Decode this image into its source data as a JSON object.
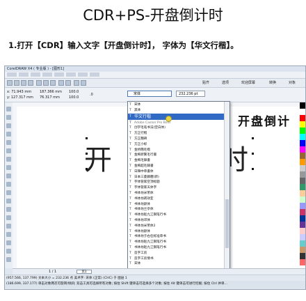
{
  "heading": "CDR+PS-开盘倒计时",
  "step1": "1.打开【CDR】输入文字【开盘倒计时】， 字体为【华文行楷】。",
  "app": {
    "window_title": "CorelDRAW X4 ( 专业版 ) - [图形1]",
    "toolbar_labels": [
      "贴齐",
      "选项",
      "欢迎屏幕",
      "转换",
      "对象"
    ],
    "coords": {
      "x": "x: 71.943 mm",
      "y": "y: 127.317 mm",
      "w": "187.366 mm",
      "h": "76.317 mm",
      "sx": "100.0",
      "sy": "100.0",
      "angle": ".0"
    },
    "font_value": "宋体",
    "size_value": "232.236 pt"
  },
  "dropdown": {
    "items": [
      {
        "label": "宋体",
        "state": "normal"
      },
      {
        "label": "黑体",
        "state": "normal"
      },
      {
        "label": "华文行楷",
        "state": "selected"
      },
      {
        "label": "Adobe Caslon Pro Bold",
        "state": "dim"
      },
      {
        "label": "创学毛笔书法(空白体)",
        "state": "normal"
      },
      {
        "label": "方正行楷",
        "state": "normal"
      },
      {
        "label": "方正魏碑",
        "state": "normal"
      },
      {
        "label": "方正小标",
        "state": "normal"
      },
      {
        "label": "金桥簡毛楷",
        "state": "normal"
      },
      {
        "label": "金梅新繁毛行書",
        "state": "normal"
      },
      {
        "label": "金梅毛隸書",
        "state": "normal"
      },
      {
        "label": "金梅超毛隸書",
        "state": "normal"
      },
      {
        "label": "日韓中草書体",
        "state": "normal"
      },
      {
        "label": "日本三菱藤體(新)",
        "state": "normal"
      },
      {
        "label": "字体管家空顶标题",
        "state": "normal"
      },
      {
        "label": "字体管家天体字",
        "state": "normal"
      },
      {
        "label": "书体坊米芾体",
        "state": "normal"
      },
      {
        "label": "书体坊禚效亚",
        "state": "normal"
      },
      {
        "label": "书体坊颜体",
        "state": "normal"
      },
      {
        "label": "书体坊兰亭体",
        "state": "normal"
      },
      {
        "label": "书体坊赵九江钢笔行书",
        "state": "normal"
      },
      {
        "label": "书体坊邓体",
        "state": "normal"
      },
      {
        "label": "书体坊米芾体2",
        "state": "normal"
      },
      {
        "label": "书体坊颜体",
        "state": "normal"
      },
      {
        "label": "书体坊于右任标准草书",
        "state": "normal"
      },
      {
        "label": "书体坊赵九江钢笔行书",
        "state": "normal"
      },
      {
        "label": "书体坊赵九江钢笔行书",
        "state": "normal"
      },
      {
        "label": "造字工房",
        "state": "normal"
      },
      {
        "label": "造字工房情书",
        "state": "normal"
      },
      {
        "label": "宋体",
        "state": "normal"
      }
    ]
  },
  "canvas": {
    "big_text_visible": "开",
    "big_text_tail": "时",
    "preview_text": "开盘倒计"
  },
  "page": {
    "counter": "1 / 1",
    "tab": "页1"
  },
  "status": {
    "line1": "(957.566, 137.799)  文本大小 = 232.236 点                                                美术字: 宋体 (正常) (CHC) 于 图层 1",
    "line2": "(186.699, 337.177)   单击对象两次可旋转/倾斜; 双击工具可选择所有对象; 按住 Shift 键单击可选择多个对象; 按住 Alt 键单击可进行挖掘; 按住 Ctrl 并单..."
  },
  "palette": [
    "#000000",
    "#ffffff",
    "#ff0000",
    "#ffff00",
    "#00ff00",
    "#00ffff",
    "#0000ff",
    "#ff00ff",
    "#996633",
    "#ff9900",
    "#cccccc",
    "#999999",
    "#666666",
    "#339966",
    "#ffcc99",
    "#ccffcc",
    "#9999ff",
    "#cc3366",
    "#003399",
    "#663399",
    "#ffcccc",
    "#ccccff",
    "#66cccc",
    "#cc9966",
    "#333333",
    "#ff6666"
  ]
}
